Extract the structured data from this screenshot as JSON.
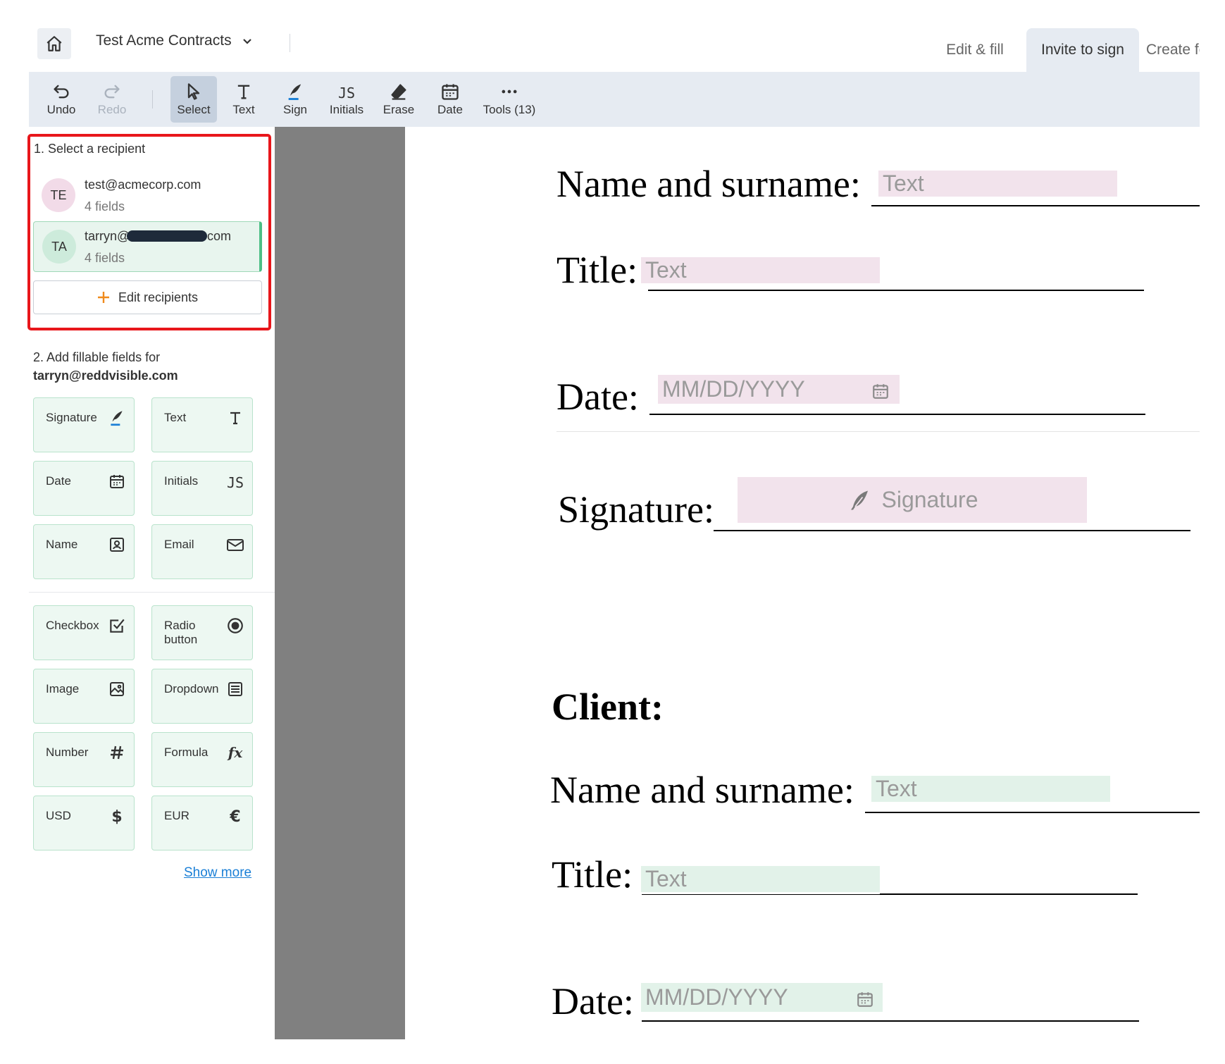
{
  "header": {
    "doc_title": "Test Acme Contracts",
    "tabs": [
      {
        "label": "Edit & fill"
      },
      {
        "label": "Invite to sign"
      },
      {
        "label": "Create fc"
      }
    ]
  },
  "toolbar": {
    "tools": [
      {
        "label": "Undo",
        "icon": "undo-icon"
      },
      {
        "label": "Redo",
        "icon": "redo-icon"
      },
      {
        "label": "Select",
        "icon": "cursor-icon"
      },
      {
        "label": "Text",
        "icon": "text-icon"
      },
      {
        "label": "Sign",
        "icon": "pen-icon"
      },
      {
        "label": "Initials",
        "icon": "initials-icon"
      },
      {
        "label": "Erase",
        "icon": "eraser-icon"
      },
      {
        "label": "Date",
        "icon": "calendar-icon"
      },
      {
        "label": "Tools (13)",
        "icon": "more-icon"
      }
    ]
  },
  "recipients": {
    "heading": "1. Select a recipient",
    "items": [
      {
        "initials": "TE",
        "email": "test@acmecorp.com",
        "fields": "4 fields",
        "color": "#f2dbe8"
      },
      {
        "initials": "TA",
        "email_start": "tarryn@",
        "email_end": "com",
        "fields": "4 fields",
        "color": "#cdebdb"
      }
    ],
    "edit_label": "Edit recipients"
  },
  "fields_panel": {
    "heading": "2. Add fillable fields for",
    "recipient": "tarryn@reddvisible.com",
    "group1": [
      {
        "label": "Signature",
        "icon": "feather-icon"
      },
      {
        "label": "Text",
        "icon": "text-icon"
      },
      {
        "label": "Date",
        "icon": "calendar-icon"
      },
      {
        "label": "Initials",
        "icon": "initials-icon"
      },
      {
        "label": "Name",
        "icon": "contact-card-icon"
      },
      {
        "label": "Email",
        "icon": "envelope-icon"
      }
    ],
    "group2": [
      {
        "label": "Checkbox",
        "icon": "checkbox-icon"
      },
      {
        "label": "Radio\nbutton",
        "icon": "radio-icon"
      },
      {
        "label": "Image",
        "icon": "image-icon"
      },
      {
        "label": "Dropdown",
        "icon": "dropdown-list-icon"
      },
      {
        "label": "Number",
        "icon": "hash-icon"
      },
      {
        "label": "Formula",
        "icon": "fx-icon"
      },
      {
        "label": "USD",
        "icon": "dollar-icon"
      },
      {
        "label": "EUR",
        "icon": "euro-icon"
      }
    ],
    "show_more": "Show more"
  },
  "document": {
    "name_label": "Name and surname:",
    "title_label": "Title:",
    "date_label": "Date:",
    "signature_label": "Signature:",
    "client_label": "Client:",
    "text_placeholder": "Text",
    "date_placeholder": "MM/DD/YYYY",
    "signature_placeholder": "Signature",
    "colors": {
      "recipient1": "#f2e3ec",
      "recipient2": "#e2f2e9"
    }
  }
}
